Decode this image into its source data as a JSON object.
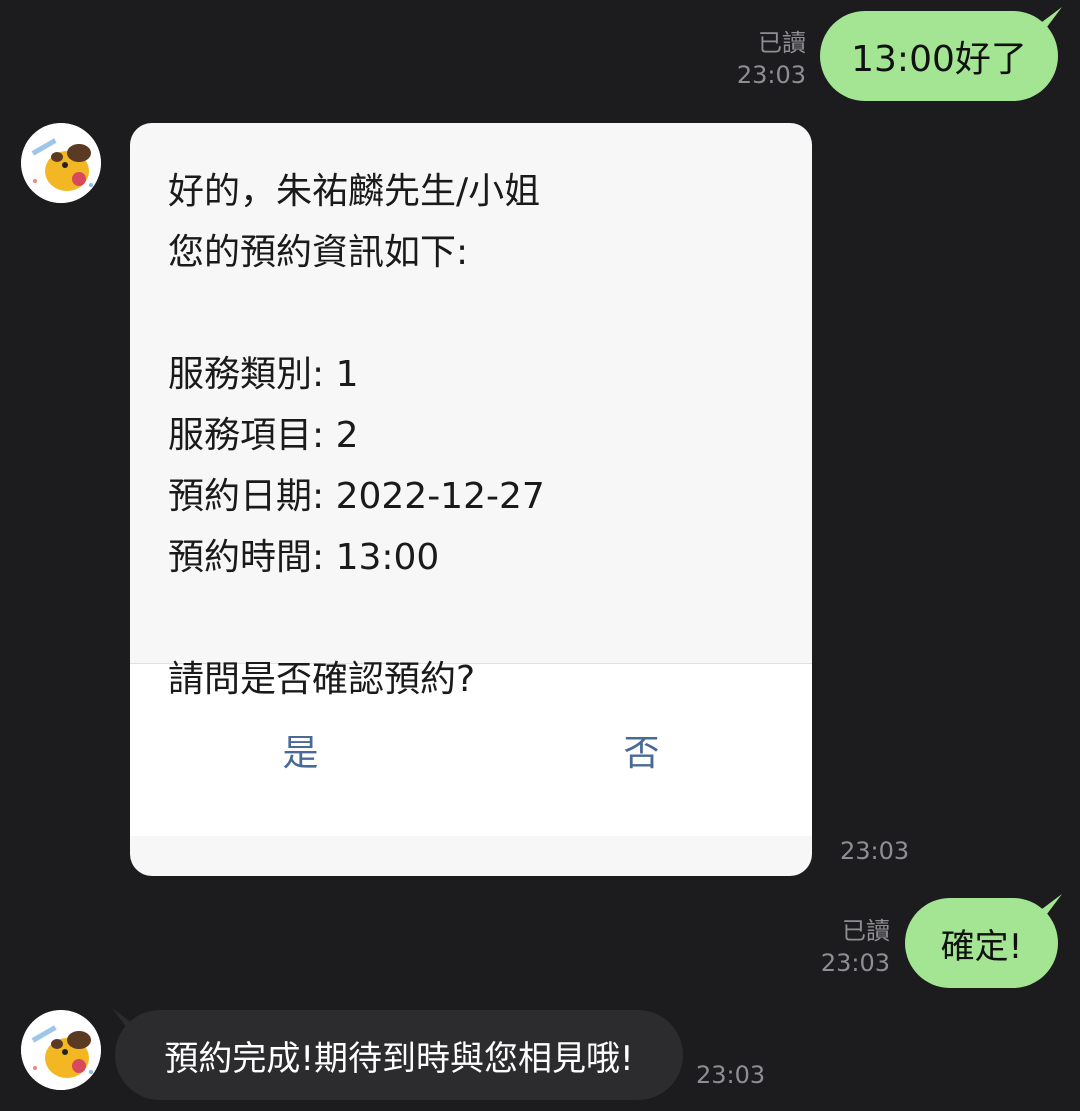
{
  "messages": {
    "m1": {
      "text": "13:00好了",
      "read": "已讀",
      "time": "23:03"
    },
    "card": {
      "lines": [
        "好的，朱祐麟先生/小姐",
        "您的預約資訊如下:",
        "",
        "服務類別: 1",
        "服務項目: 2",
        "預約日期: 2022-12-27",
        "預約時間: 13:00",
        "",
        "請問是否確認預約?"
      ],
      "yes_label": "是",
      "no_label": "否",
      "time": "23:03"
    },
    "m2": {
      "text": "確定!",
      "read": "已讀",
      "time": "23:03"
    },
    "m3": {
      "text": "預約完成!期待到時與您相見哦!",
      "time": "23:03"
    }
  },
  "colors": {
    "background": "#1c1c1e",
    "outgoing_bubble": "#a4e594",
    "incoming_bubble": "#2c2c2e",
    "card_background": "#f7f7f8",
    "action_text": "#4a6a96",
    "meta_text": "#8e8e93"
  },
  "icons": {
    "avatar": "cartoon-dog-avatar-icon"
  }
}
